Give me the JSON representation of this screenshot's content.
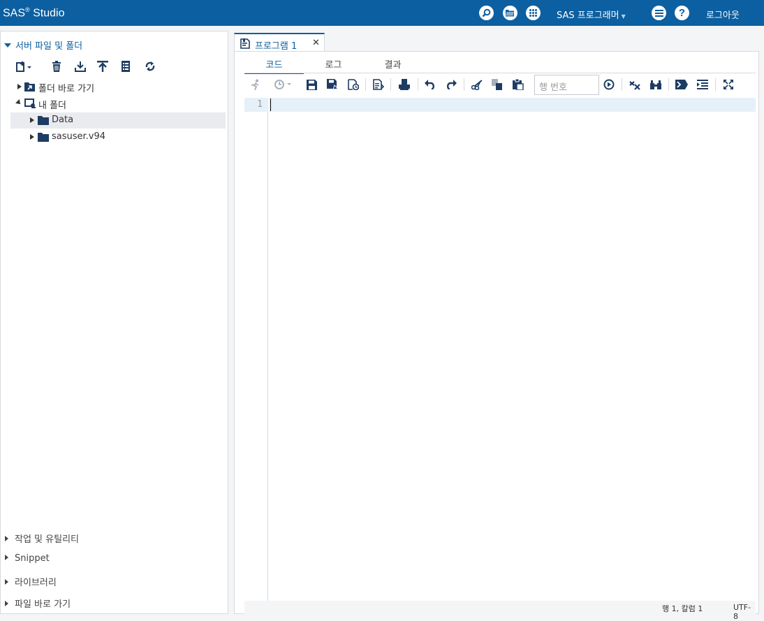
{
  "app": {
    "brand": "SAS",
    "brand_sup": "®",
    "brand_suffix": "Studio",
    "perspective": "SAS 프로그래머",
    "logout": "로그아웃"
  },
  "left": {
    "panel_title": "서버 파일 및 폴더",
    "tree": [
      {
        "label": "폴더 바로 가기"
      },
      {
        "label": "내 폴더"
      },
      {
        "label": "Data"
      },
      {
        "label": "sasuser.v94"
      }
    ],
    "accordions": [
      "작업 및 유틸리티",
      "Snippet",
      "라이브러리",
      "파일 바로 가기"
    ]
  },
  "editor": {
    "tab_title": "프로그램 1",
    "tab_close": "✕",
    "subtabs": [
      "코드",
      "로그",
      "결과"
    ],
    "line_placeholder": "행 번호",
    "line_numbers": [
      "1"
    ],
    "status_position": "행 1, 칼럼 1",
    "status_encoding": "UTF-8"
  }
}
